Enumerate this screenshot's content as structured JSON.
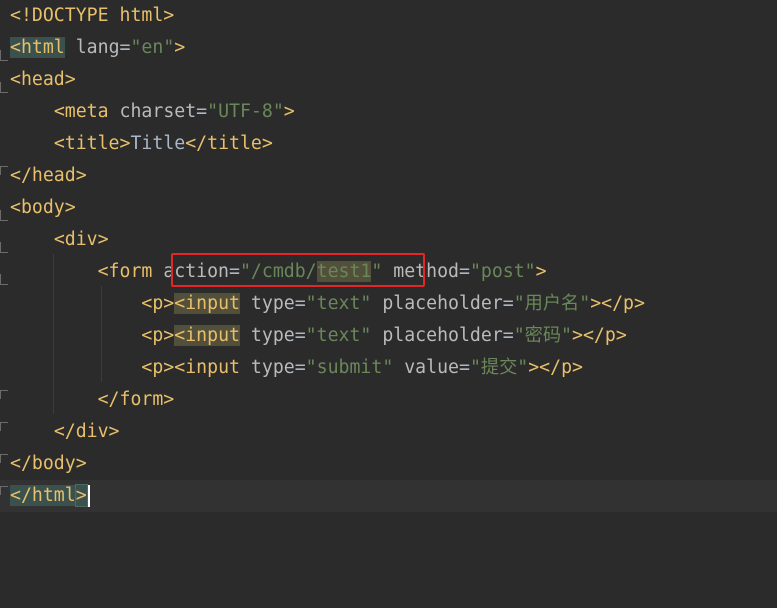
{
  "editor": {
    "language": "html",
    "highlight_box_color": "#e32626",
    "lines": [
      {
        "t1": "<!DOCTYPE html>"
      },
      {
        "tag_open": "<",
        "tag_name": "html",
        "a1": "lang",
        "eq": "=",
        "v1": "\"en\"",
        "tag_close": ">"
      },
      {
        "tag": "<head>"
      },
      {
        "t_open": "<meta ",
        "a1": "charset",
        "eq": "=",
        "v1": "\"UTF-8\"",
        "t_close": ">"
      },
      {
        "t_open": "<title>",
        "text": "Title",
        "t_close": "</title>"
      },
      {
        "tag": "</head>"
      },
      {
        "tag": "<body>"
      },
      {
        "tag": "<div>"
      },
      {
        "t_open": "<form ",
        "a1": "action",
        "eq": "=",
        "v1a": "\"/cmdb/",
        "v1b": "test1",
        "v1c": "\"",
        "a2": " method",
        "eq2": "=",
        "v2": "\"post\"",
        "t_close": ">"
      },
      {
        "p_open": "<p>",
        "i_open": "<",
        "i_name": "input",
        "a1": " type",
        "eq": "=",
        "v1": "\"text\"",
        "a2": " placeholder",
        "eq2": "=",
        "v2": "\"用户名\"",
        "t_close": "></p>"
      },
      {
        "p_open": "<p>",
        "i_open": "<",
        "i_name": "input",
        "a1": " type",
        "eq": "=",
        "v1": "\"text\"",
        "a2": " placeholder",
        "eq2": "=",
        "v2": "\"密码\"",
        "t_close": "></p>"
      },
      {
        "p_open": "<p>",
        "i_open": "<input",
        "a1": " type",
        "eq": "=",
        "v1": "\"submit\"",
        "a2": " value",
        "eq2": "=",
        "v2": "\"提交\"",
        "t_close": "></p>"
      },
      {
        "tag": "</form>"
      },
      {
        "tag": "</div>"
      },
      {
        "tag": "</body>"
      },
      {
        "tag_a": "</html",
        "tag_b": ">"
      }
    ]
  }
}
